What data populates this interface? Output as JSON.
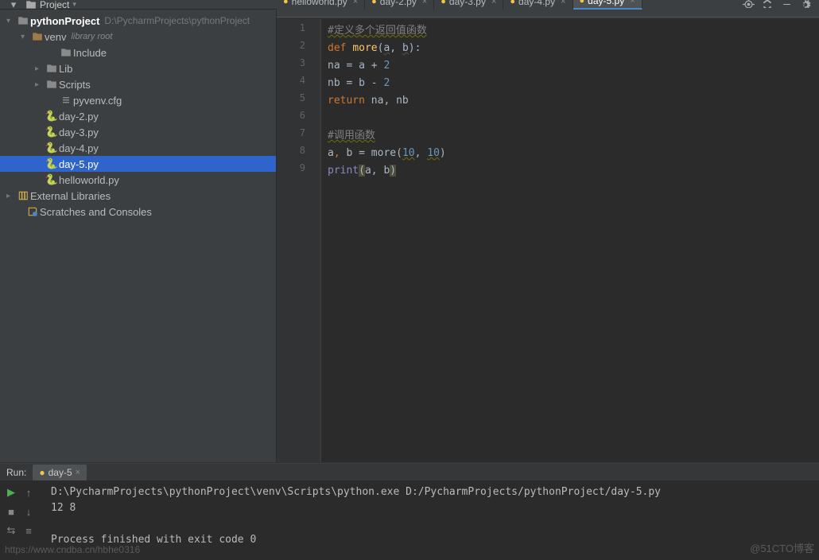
{
  "toolbar": {
    "project_label": "Project"
  },
  "project_tree": {
    "root": {
      "name": "pythonProject",
      "path": "D:\\PycharmProjects\\pythonProject"
    },
    "venv": {
      "name": "venv",
      "note": "library root"
    },
    "include": "Include",
    "lib": "Lib",
    "scripts": "Scripts",
    "pyvenv": "pyvenv.cfg",
    "files": [
      "day-2.py",
      "day-3.py",
      "day-4.py",
      "day-5.py",
      "helloworld.py"
    ],
    "ext_lib": "External Libraries",
    "scratch": "Scratches and Consoles"
  },
  "editor_tabs": [
    {
      "label": "helloworld.py",
      "active": false,
      "partial": true
    },
    {
      "label": "day-2.py",
      "active": false,
      "partial": true
    },
    {
      "label": "day-3.py",
      "active": false,
      "partial": true
    },
    {
      "label": "day-4.py",
      "active": false,
      "partial": true
    },
    {
      "label": "day-5.py",
      "active": true,
      "partial": true
    }
  ],
  "code": {
    "line1_comment": "#定义多个返回值函数",
    "line2_def": "def",
    "line2_fn": "more",
    "line2_body": "(a, b):",
    "line3_a": "na = a + ",
    "line3_num": "2",
    "line4_a": "nb = b - ",
    "line4_num": "2",
    "line5_ret": "return",
    "line5_body": " na, nb",
    "line7_comment": "#调用函数",
    "line8_a": "a",
    "line8_b": " b = more(",
    "line8_n1": "10",
    "line8_c": ", ",
    "line8_n2": "10",
    "line8_d": ")",
    "line9_print": "print",
    "line9_body": "(a, b",
    "line9_close": ")"
  },
  "line_numbers": [
    "1",
    "2",
    "3",
    "4",
    "5",
    "6",
    "7",
    "8",
    "9"
  ],
  "run": {
    "label": "Run:",
    "tab": "day-5",
    "cmd": "D:\\PycharmProjects\\pythonProject\\venv\\Scripts\\python.exe D:/PycharmProjects/pythonProject/day-5.py",
    "out": "12 8",
    "exit": "Process finished with exit code 0"
  },
  "watermarks": {
    "right": "@51CTO博客",
    "left": "https://www.cndba.cn/hbhe0316"
  }
}
